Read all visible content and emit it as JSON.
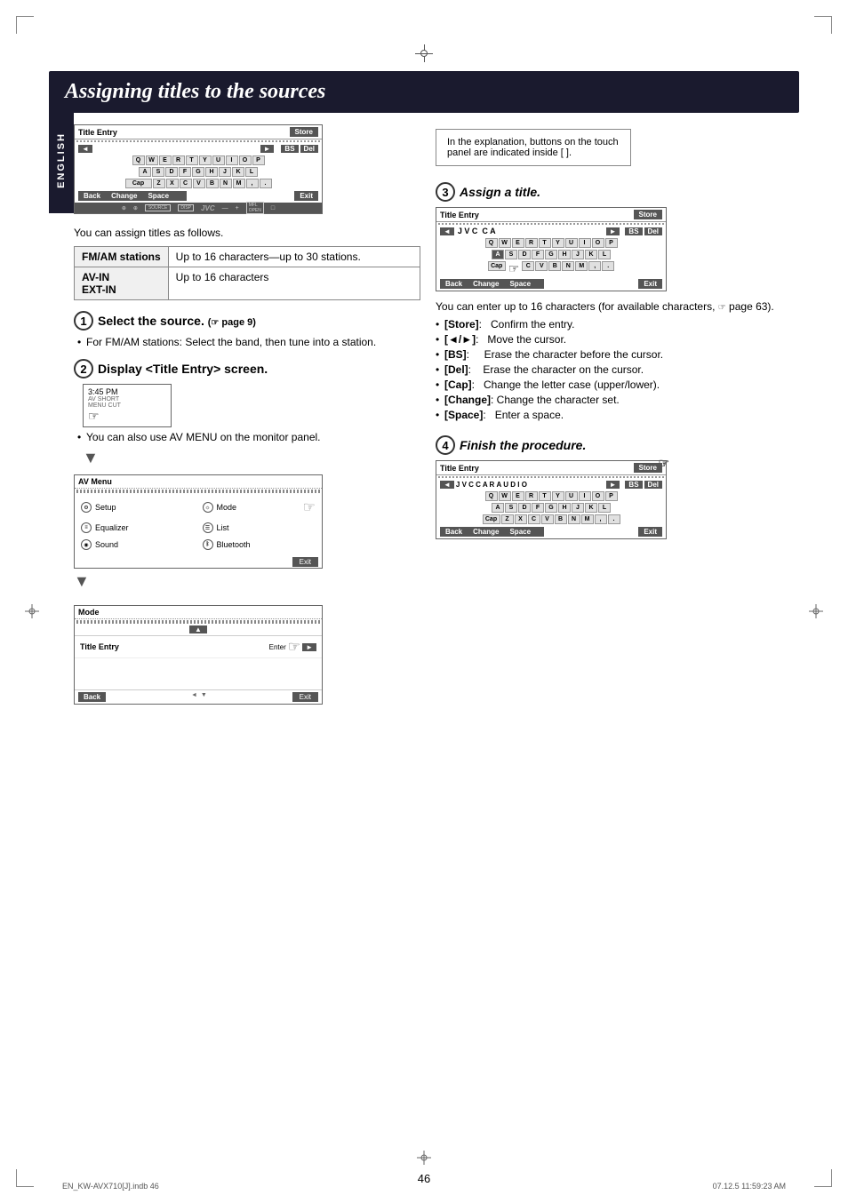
{
  "page": {
    "title": "Assigning titles to the sources",
    "language": "ENGLISH",
    "page_number": "46",
    "footer_left": "EN_KW-AVX710[J].indb  46",
    "footer_right": "07.12.5  11:59:23 AM"
  },
  "note_box": {
    "text": "In the explanation, buttons on the touch panel are indicated inside [     ]."
  },
  "intro_text": "You can assign titles as follows.",
  "table": {
    "rows": [
      {
        "label": "FM/AM stations",
        "value": "Up to 16 characters—up to 30 stations."
      },
      {
        "label": "AV-IN\nEXT-IN",
        "value": "Up to 16 characters"
      }
    ]
  },
  "steps": [
    {
      "number": "1",
      "heading": "Select the source.",
      "sub": "( page 9)",
      "bullets": [
        "For FM/AM stations: Select the band, then tune into a station."
      ]
    },
    {
      "number": "2",
      "heading": "Display <Title Entry> screen.",
      "bullets": [
        "You can also use AV MENU on the monitor panel."
      ]
    },
    {
      "number": "3",
      "heading": "Assign a title.",
      "description": "You can enter up to 16 characters (for available characters,  page 63).",
      "bullets": [
        "[Store]:  Confirm the entry.",
        "[◄/►]:  Move the cursor.",
        "[BS]:  Erase the character before the cursor.",
        "[Del]:  Erase the character on the cursor.",
        "[Cap]:  Change the letter case (upper/lower).",
        "[Change]:  Change the character set.",
        "[Space]:  Enter a space."
      ]
    },
    {
      "number": "4",
      "heading": "Finish the procedure."
    }
  ],
  "screens": {
    "title_entry_empty": {
      "title": "Title Entry",
      "store_btn": "Store",
      "bs_btn": "BS",
      "del_btn": "Del",
      "back_btn": "Back",
      "change_btn": "Change",
      "space_btn": "Space",
      "exit_btn": "Exit",
      "keys_row1": [
        "Q",
        "W",
        "E",
        "R",
        "T",
        "Y",
        "U",
        "I",
        "O",
        "P"
      ],
      "keys_row2": [
        "A",
        "S",
        "D",
        "F",
        "G",
        "H",
        "J",
        "K",
        "L"
      ],
      "keys_row3": [
        "Cap",
        "Z",
        "X",
        "C",
        "V",
        "B",
        "N",
        "M",
        ",",
        "."
      ]
    },
    "title_entry_jvc_ca": {
      "title": "Title Entry",
      "text": "J V C  C A",
      "store_btn": "Store",
      "bs_btn": "BS",
      "del_btn": "Del",
      "back_btn": "Back",
      "change_btn": "Change",
      "space_btn": "Space",
      "exit_btn": "Exit"
    },
    "title_entry_jvc_car_audio": {
      "title": "Title Entry",
      "text": "J V C  C A R  A U D I O",
      "store_btn": "Store",
      "bs_btn": "BS",
      "del_btn": "Del",
      "back_btn": "Back",
      "change_btn": "Change",
      "space_btn": "Space",
      "exit_btn": "Exit"
    },
    "av_menu": {
      "title": "AV Menu",
      "items": [
        {
          "icon": "gear",
          "label": "Setup"
        },
        {
          "icon": "sun",
          "label": "Mode"
        },
        {
          "icon": "eq",
          "label": "Equalizer"
        },
        {
          "icon": "list",
          "label": "List"
        },
        {
          "icon": "sound",
          "label": "Sound"
        },
        {
          "icon": "bt",
          "label": "Bluetooth"
        }
      ],
      "exit_btn": "Exit"
    },
    "mode_screen": {
      "title": "Mode",
      "entry_label": "Title Entry",
      "enter_label": "Enter",
      "back_btn": "Back",
      "exit_btn": "Exit"
    },
    "time_display": "3:45 PM"
  }
}
